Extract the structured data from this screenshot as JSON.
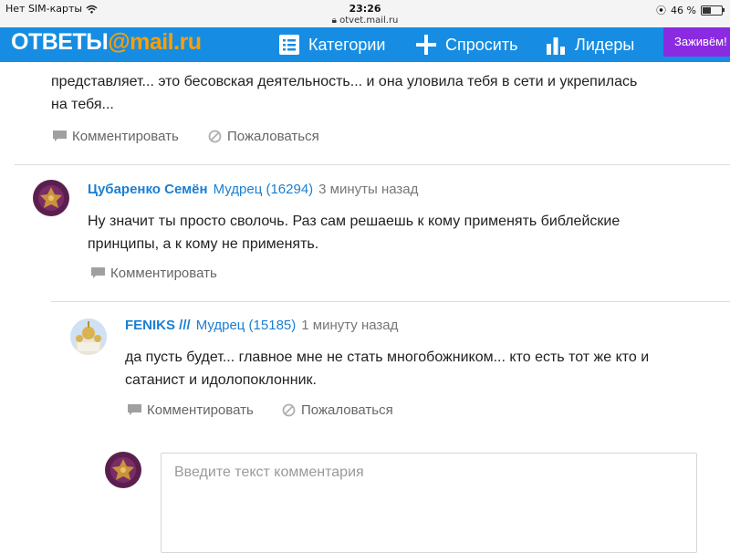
{
  "status_bar": {
    "carrier": "Нет SIM-карты",
    "time": "23:26",
    "url": "otvet.mail.ru",
    "battery": "46 %",
    "battery_level": 0.46
  },
  "header": {
    "logo_main": "ОТВЕТЫ",
    "logo_at": "@",
    "logo_domain": "mail.ru",
    "nav": {
      "categories": "Категории",
      "ask": "Спросить",
      "leaders": "Лидеры"
    },
    "live_button": "Заживём!"
  },
  "prev_comment": {
    "text_line1": "представляет... это бесовская деятельность... и она уловила тебя в сети и укрепилась",
    "text_line2": "на тебя...",
    "comment_label": "Комментировать",
    "report_label": "Пожаловаться"
  },
  "comment1": {
    "author": "Цубаренко Семён",
    "rank": "Мудрец (16294)",
    "time": "3 минуты назад",
    "text_line1": "Ну значит ты просто сволочь. Раз сам решаешь к кому применять библейские",
    "text_line2": "принципы, а к кому не применять.",
    "comment_label": "Комментировать"
  },
  "comment2": {
    "author": "FENIKS ///",
    "rank": "Мудрец (15185)",
    "time": "1 минуту назад",
    "text_line1": "да пусть будет... главное мне не стать многобожником... кто есть тот же кто и",
    "text_line2": "сатанист и идолопоклонник.",
    "comment_label": "Комментировать",
    "report_label": "Пожаловаться"
  },
  "comment_form": {
    "placeholder": "Введите текст комментария"
  }
}
